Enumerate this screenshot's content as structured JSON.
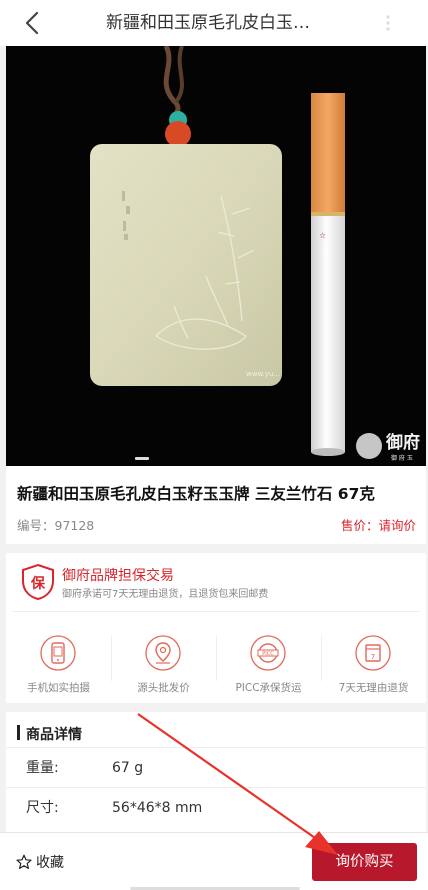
{
  "header": {
    "back_icon": "back-chevron-icon",
    "title": "新疆和田玉原毛孔皮白玉…"
  },
  "gallery": {
    "watermark": "御府",
    "watermark_sub": "御 府 玉",
    "site_mark": "www.yu..."
  },
  "product": {
    "title": "新疆和田玉原毛孔皮白玉籽玉玉牌 三友兰竹石 67克",
    "code": "编号：97128",
    "price": "售价：请询价"
  },
  "guarantee": {
    "badge_char": "保",
    "title": "御府品牌担保交易",
    "subtitle": "御府承诺可7天无理由退货，且退货包来回邮费",
    "features": [
      {
        "label": "手机如实拍摄",
        "icon": "phone-camera-icon"
      },
      {
        "label": "源头批发价",
        "icon": "location-pin-icon"
      },
      {
        "label": "PICC承保货运",
        "icon": "picc-insurance-icon"
      },
      {
        "label": "7天无理由退货",
        "icon": "return-7day-icon"
      }
    ]
  },
  "details": {
    "title": "商品详情",
    "rows": [
      {
        "key": "重量:",
        "value": "67 g"
      },
      {
        "key": "尺寸:",
        "value": "56*46*8 mm"
      }
    ]
  },
  "bottom_bar": {
    "favorite_label": "收藏",
    "inquire_label": "询价购买"
  },
  "colors": {
    "accent_red": "#d8262c",
    "button_red": "#b8182b",
    "annotation_arrow": "#e8322c"
  }
}
